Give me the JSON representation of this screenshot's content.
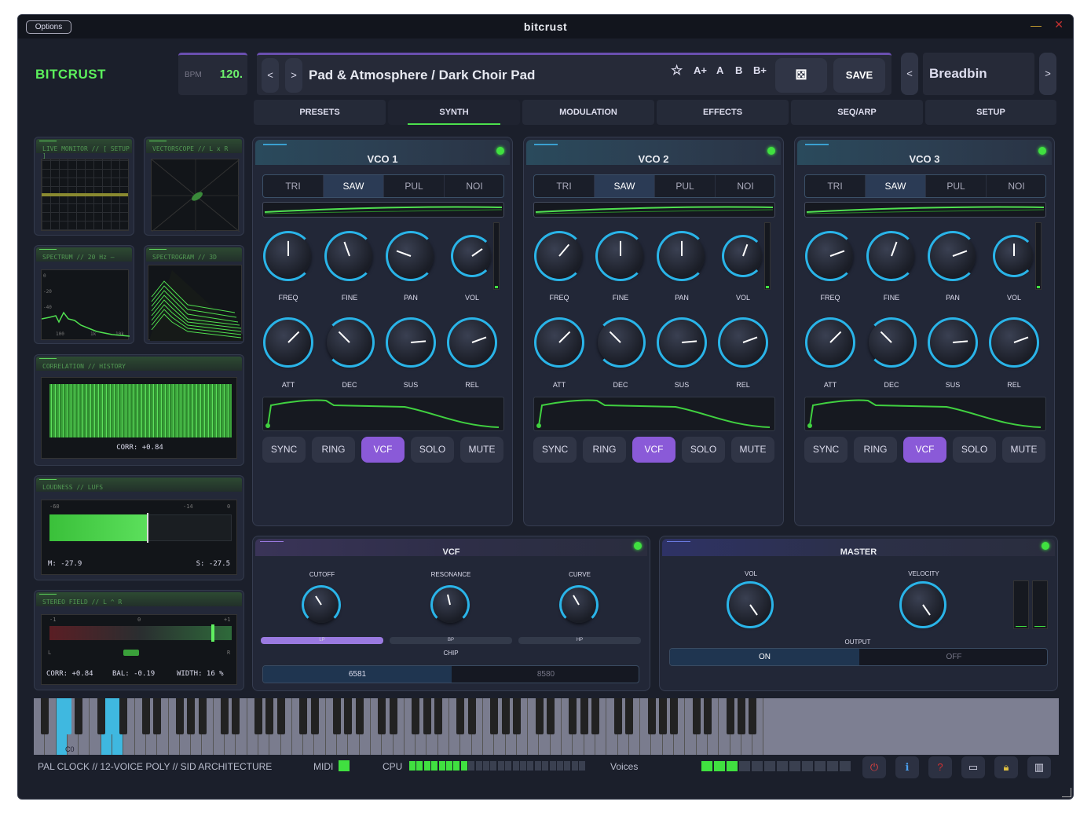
{
  "window": {
    "title": "bitcrust",
    "options_label": "Options"
  },
  "brand": {
    "logo": "BITCRUST"
  },
  "bpm": {
    "label": "BPM",
    "value": "120."
  },
  "preset": {
    "prev": "<",
    "next": ">",
    "name": "Pad & Atmosphere / Dark Choir Pad",
    "buttons": [
      "A+",
      "A",
      "B",
      "B+"
    ],
    "star_icon": "star-icon",
    "random_icon": "dice-icon",
    "save_label": "SAVE"
  },
  "bank": {
    "prev": "<",
    "next": ">",
    "name": "Breadbin"
  },
  "tabs": [
    "PRESETS",
    "SYNTH",
    "MODULATION",
    "EFFECTS",
    "SEQ/ARP",
    "SETUP"
  ],
  "active_tab": "SYNTH",
  "monitors": {
    "live": "LIVE MONITOR // [ SETUP ]",
    "vectorscope": "VECTORSCOPE // L x R",
    "spectrum": "SPECTRUM // 20 Hz –",
    "spectrum_ticks": [
      "0",
      "-20",
      "-40",
      "100",
      "1k",
      "10k"
    ],
    "spectrogram": "SPECTROGRAM // 3D",
    "correlation": "CORRELATION // HISTORY",
    "corr_value": "CORR: +0.84",
    "loudness": "LOUDNESS // LUFS",
    "loud_ticks": [
      "-60",
      "-14",
      "0"
    ],
    "loud_m": "M: -27.9",
    "loud_s": "S: -27.5",
    "stereo": "STEREO FIELD // L ^ R",
    "stereo_ticks": [
      "-1",
      "0",
      "+1"
    ],
    "stereo_lr": [
      "L",
      "R"
    ],
    "stereo_corr": "CORR: +0.84",
    "stereo_bal": "BAL: -0.19",
    "stereo_width": "WIDTH: 16 %"
  },
  "vcos": [
    {
      "title": "VCO 1",
      "waves": [
        "TRI",
        "SAW",
        "PUL",
        "NOI"
      ],
      "selected_wave": "SAW",
      "knobs_top": [
        "FREQ",
        "FINE",
        "PAN",
        "VOL"
      ],
      "knobs_bottom": [
        "ATT",
        "DEC",
        "SUS",
        "REL"
      ],
      "buttons": [
        "SYNC",
        "RING",
        "VCF",
        "SOLO",
        "MUTE"
      ],
      "active_button": "VCF"
    },
    {
      "title": "VCO 2",
      "waves": [
        "TRI",
        "SAW",
        "PUL",
        "NOI"
      ],
      "selected_wave": "SAW",
      "knobs_top": [
        "FREQ",
        "FINE",
        "PAN",
        "VOL"
      ],
      "knobs_bottom": [
        "ATT",
        "DEC",
        "SUS",
        "REL"
      ],
      "buttons": [
        "SYNC",
        "RING",
        "VCF",
        "SOLO",
        "MUTE"
      ],
      "active_button": "VCF"
    },
    {
      "title": "VCO 3",
      "waves": [
        "TRI",
        "SAW",
        "PUL",
        "NOI"
      ],
      "selected_wave": "SAW",
      "knobs_top": [
        "FREQ",
        "FINE",
        "PAN",
        "VOL"
      ],
      "knobs_bottom": [
        "ATT",
        "DEC",
        "SUS",
        "REL"
      ],
      "buttons": [
        "SYNC",
        "RING",
        "VCF",
        "SOLO",
        "MUTE"
      ],
      "active_button": "VCF"
    }
  ],
  "vcf": {
    "title": "VCF",
    "knobs": [
      "CUTOFF",
      "RESONANCE",
      "CURVE"
    ],
    "filters": [
      "LP",
      "BP",
      "HP"
    ],
    "selected_filter": "LP",
    "chip_label": "CHIP",
    "chips": [
      "6581",
      "8580"
    ],
    "selected_chip": "6581"
  },
  "master": {
    "title": "MASTER",
    "knobs": [
      "VOL",
      "VELOCITY"
    ],
    "output_label": "OUTPUT",
    "output": [
      "ON",
      "OFF"
    ],
    "selected_output": "ON"
  },
  "piano": {
    "c0_label": "C0"
  },
  "status": {
    "text": "PAL CLOCK // 12-VOICE POLY // SID ARCHITECTURE",
    "midi_label": "MIDI",
    "cpu_label": "CPU",
    "voices_label": "Voices",
    "cpu_level": 0.33,
    "voices_active": 3,
    "voices_total": 12
  },
  "colors": {
    "accent_green": "#40e040",
    "accent_purple": "#8a5ad8",
    "accent_cyan": "#2ab4e8"
  }
}
